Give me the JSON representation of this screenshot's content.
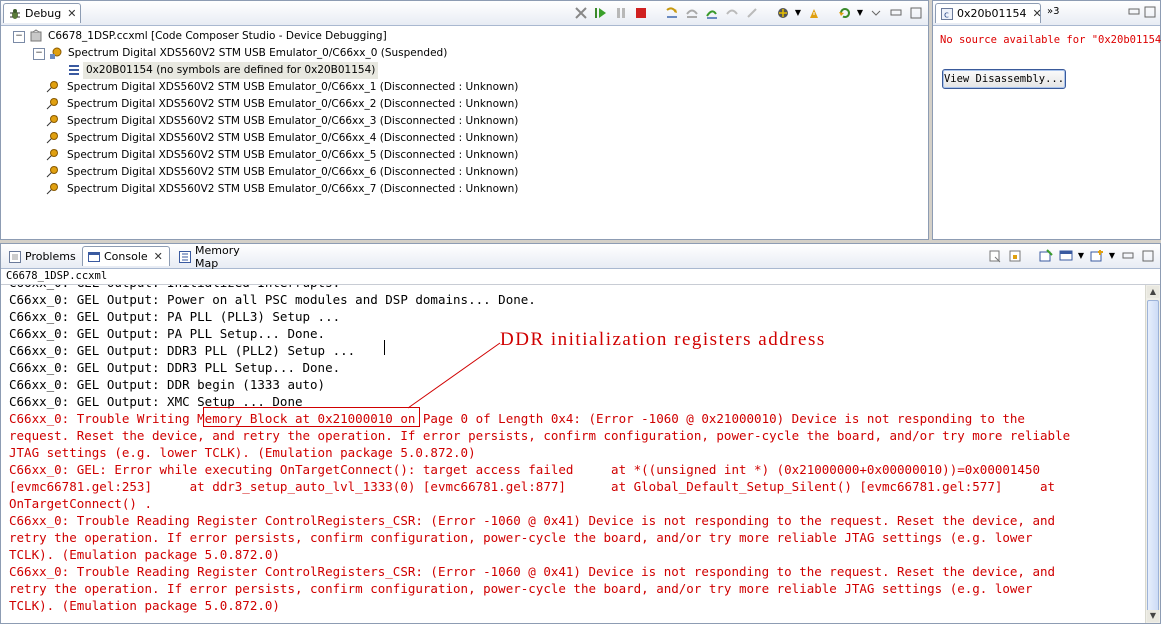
{
  "debug": {
    "tab_label": "Debug",
    "tree": [
      {
        "label": "C6678_1DSP.ccxml [Code Composer Studio - Device Debugging]"
      },
      {
        "label": "Spectrum Digital XDS560V2 STM USB Emulator_0/C66xx_0 (Suspended)"
      },
      {
        "label": "0x20B01154  (no symbols are defined for 0x20B01154)"
      },
      {
        "label": "Spectrum Digital XDS560V2 STM USB Emulator_0/C66xx_1 (Disconnected : Unknown)"
      },
      {
        "label": "Spectrum Digital XDS560V2 STM USB Emulator_0/C66xx_2 (Disconnected : Unknown)"
      },
      {
        "label": "Spectrum Digital XDS560V2 STM USB Emulator_0/C66xx_3 (Disconnected : Unknown)"
      },
      {
        "label": "Spectrum Digital XDS560V2 STM USB Emulator_0/C66xx_4 (Disconnected : Unknown)"
      },
      {
        "label": "Spectrum Digital XDS560V2 STM USB Emulator_0/C66xx_5 (Disconnected : Unknown)"
      },
      {
        "label": "Spectrum Digital XDS560V2 STM USB Emulator_0/C66xx_6 (Disconnected : Unknown)"
      },
      {
        "label": "Spectrum Digital XDS560V2 STM USB Emulator_0/C66xx_7 (Disconnected : Unknown)"
      }
    ]
  },
  "source": {
    "tab_label": "0x20b01154",
    "overflow_label": "»3",
    "message": "No source available for \"0x20b01154\"",
    "button_label": "View Disassembly..."
  },
  "bottom_tabs": {
    "problems": "Problems",
    "console": "Console",
    "memory_map": "Memory Map"
  },
  "console": {
    "title": "C6678_1DSP.ccxml",
    "lines": [
      {
        "text": "C66xx_0: GEL Output: Power on all PSC modules and DSP domains... Done.",
        "style": "black"
      },
      {
        "text": "C66xx_0: GEL Output: PA PLL (PLL3) Setup ...",
        "style": "black"
      },
      {
        "text": "C66xx_0: GEL Output: PA PLL Setup... Done.",
        "style": "black"
      },
      {
        "text": "C66xx_0: GEL Output: DDR3 PLL (PLL2) Setup ...",
        "style": "black"
      },
      {
        "text": "C66xx_0: GEL Output: DDR3 PLL Setup... Done.",
        "style": "black"
      },
      {
        "text": "C66xx_0: GEL Output: DDR begin (1333 auto)",
        "style": "black"
      },
      {
        "text": "C66xx_0: GEL Output: XMC Setup ... Done",
        "style": "black"
      },
      {
        "text": "C66xx_0: Trouble Writing Memory Block at 0x21000010 on Page 0 of Length 0x4: (Error -1060 @ 0x21000010) Device is not responding to the",
        "style": "red"
      },
      {
        "text": "request. Reset the device, and retry the operation. If error persists, confirm configuration, power-cycle the board, and/or try more reliable",
        "style": "red"
      },
      {
        "text": "JTAG settings (e.g. lower TCLK). (Emulation package 5.0.872.0)",
        "style": "red"
      },
      {
        "text": "C66xx_0: GEL: Error while executing OnTargetConnect(): target access failed     at *((unsigned int *) (0x21000000+0x00000010))=0x00001450",
        "style": "red"
      },
      {
        "text": "[evmc66781.gel:253]     at ddr3_setup_auto_lvl_1333(0) [evmc66781.gel:877]      at Global_Default_Setup_Silent() [evmc66781.gel:577]     at",
        "style": "red"
      },
      {
        "text": "OnTargetConnect() .",
        "style": "red"
      },
      {
        "text": "C66xx_0: Trouble Reading Register ControlRegisters_CSR: (Error -1060 @ 0x41) Device is not responding to the request. Reset the device, and",
        "style": "red"
      },
      {
        "text": "retry the operation. If error persists, confirm configuration, power-cycle the board, and/or try more reliable JTAG settings (e.g. lower",
        "style": "red"
      },
      {
        "text": "TCLK). (Emulation package 5.0.872.0)",
        "style": "red"
      },
      {
        "text": "C66xx_0: Trouble Reading Register ControlRegisters_CSR: (Error -1060 @ 0x41) Device is not responding to the request. Reset the device, and",
        "style": "red"
      },
      {
        "text": "retry the operation. If error persists, confirm configuration, power-cycle the board, and/or try more reliable JTAG settings (e.g. lower",
        "style": "red"
      },
      {
        "text": "TCLK). (Emulation package 5.0.872.0)",
        "style": "red"
      }
    ]
  },
  "annotation": {
    "text": "DDR initialization registers address"
  },
  "colors": {
    "error_red": "#d00000",
    "panel_border": "#8d9cb3"
  }
}
